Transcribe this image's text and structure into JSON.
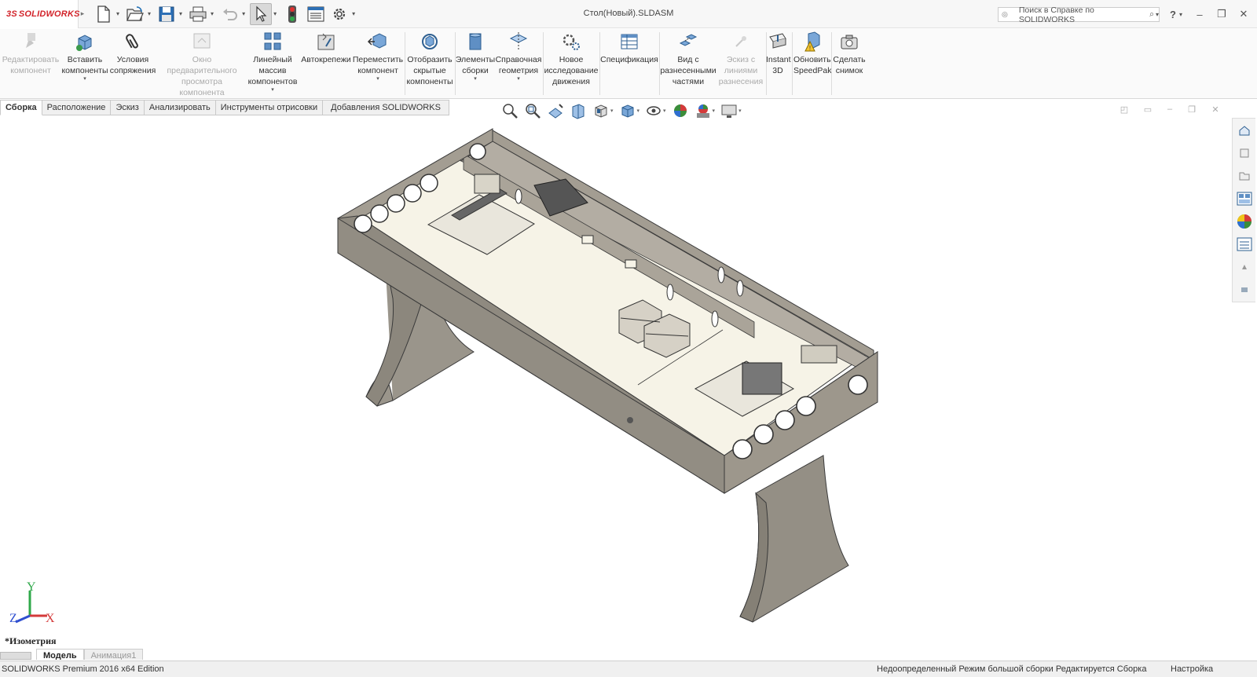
{
  "app": {
    "logo_prefix": "3S",
    "logo_text": "SOLIDWORKS",
    "document_title": "Стол(Новый).SLDASM",
    "help_search_placeholder": "Поиск в Справке по SOLIDWORKS",
    "help_label": "?"
  },
  "quick_access": [
    {
      "name": "new-document",
      "icon": "new-file-icon"
    },
    {
      "name": "open",
      "icon": "open-folder-icon"
    },
    {
      "name": "save",
      "icon": "save-icon"
    },
    {
      "name": "print",
      "icon": "print-icon"
    },
    {
      "name": "undo",
      "icon": "undo-icon"
    },
    {
      "name": "select",
      "icon": "cursor-icon"
    },
    {
      "name": "rebuild",
      "icon": "traffic-light-icon"
    },
    {
      "name": "file-properties",
      "icon": "properties-icon"
    },
    {
      "name": "options",
      "icon": "gear-icon"
    }
  ],
  "ribbon": {
    "edit_component": "Редактировать компонент",
    "insert_components": "Вставить компоненты",
    "mate": "Условия сопряжения",
    "preview_window": "Окно предварительного просмотра компонента",
    "linear_pattern": "Линейный массив компонентов",
    "smart_fasteners": "Автокрепежи",
    "move_component": "Переместить компонент",
    "show_hidden": "Отобразить скрытые компоненты",
    "assembly_features": "Элементы сборки",
    "reference_geometry": "Справочная геометрия",
    "new_motion_study": "Новое исследование движения",
    "bom": "Спецификация",
    "exploded_view": "Вид с разнесенными частями",
    "explode_line_sketch": "Эскиз с линиями разнесения",
    "instant3d": "Instant 3D",
    "update_speedpak": "Обновить SpeedPak",
    "take_snapshot": "Сделать снимок"
  },
  "tabs": [
    {
      "label": "Сборка",
      "active": true
    },
    {
      "label": "Расположение",
      "active": false
    },
    {
      "label": "Эскиз",
      "active": false
    },
    {
      "label": "Анализировать",
      "active": false
    },
    {
      "label": "Инструменты отрисовки",
      "active": false
    },
    {
      "label": "Добавления SOLIDWORKS",
      "active": false
    }
  ],
  "viewport": {
    "view_orientation": "*Изометрия",
    "triad": {
      "y": "Y",
      "z": "Z",
      "x": "X"
    },
    "model_colors": {
      "body": "#8f8a80",
      "body_light": "#a39d92",
      "floor": "#f6f3e7",
      "edge": "#3a3a3a"
    }
  },
  "bottom_tabs": [
    {
      "label": "Модель",
      "active": true
    },
    {
      "label": "Анимация1",
      "active": false
    }
  ],
  "status": {
    "edition": "SOLIDWORKS Premium 2016 x64 Edition",
    "state": "Недоопределенный  Режим большой сборки  Редактируется Сборка",
    "customize": "Настройка"
  }
}
